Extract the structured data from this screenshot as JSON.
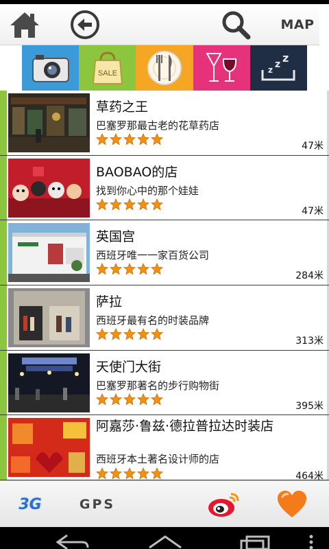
{
  "toolbar": {
    "home_icon": "home-icon",
    "back_icon": "back-arrow-icon",
    "search_icon": "search-icon",
    "map_label": "MAP"
  },
  "categories": [
    {
      "icon": "camera-icon",
      "color": "#3d9ad9"
    },
    {
      "icon": "shopping-bag-icon",
      "label": "SALE",
      "color": "#8cc63f"
    },
    {
      "icon": "plate-fork-knife-icon",
      "color": "#f5a623"
    },
    {
      "icon": "wine-glass-icon",
      "color": "#e6327a"
    },
    {
      "icon": "sleep-icon",
      "color": "#1f2d45"
    }
  ],
  "list": {
    "items": [
      {
        "name": "草药之王",
        "desc": "巴塞罗那最古老的花草药店",
        "rating": 5,
        "distance": "47米"
      },
      {
        "name": "BAOBAO的店",
        "desc": "找到你心中的那个娃娃",
        "rating": 5,
        "distance": "47米"
      },
      {
        "name": "英国宫",
        "desc": "西班牙唯一一家百货公司",
        "rating": 5,
        "distance": "284米"
      },
      {
        "name": "萨拉",
        "desc": "西班牙最有名的时装品牌",
        "rating": 5,
        "distance": "313米"
      },
      {
        "name": "天使门大街",
        "desc": "巴塞罗那著名的步行购物街",
        "rating": 5,
        "distance": "395米"
      },
      {
        "name": "阿嘉莎·鲁兹·德拉普拉达时装店",
        "desc": "西班牙本土著名设计师的店",
        "rating": 5,
        "distance": "464米"
      }
    ]
  },
  "bottombar": {
    "network_label": "3G",
    "gps_label": "GPS",
    "weibo_icon": "weibo-icon",
    "favorite_icon": "heart-icon"
  },
  "colors": {
    "accent_green": "#8cc63f",
    "star_orange": "#f29111"
  }
}
